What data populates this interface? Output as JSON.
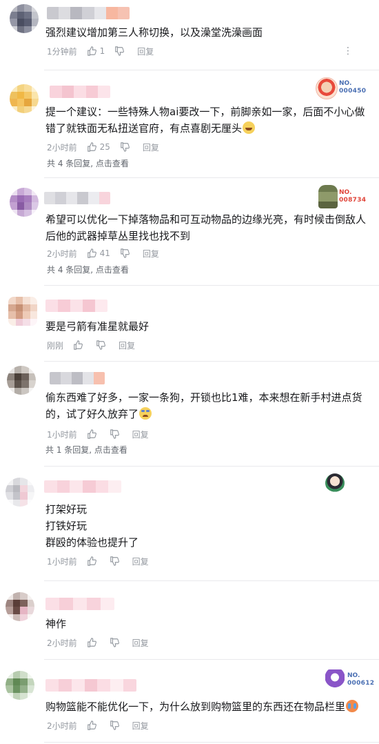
{
  "comments": [
    {
      "text": "强烈建议增加第三人称切换，以及澡堂洗澡画面",
      "time": "1分钟前",
      "likes": "1",
      "reply_label": "回复",
      "more_label": "⋮"
    },
    {
      "text": "提一个建议：一些特殊人物ai要改一下，前脚亲如一家，后面不小心做错了就铁面无私扭送官府，有点喜剧无厘头",
      "time": "2小时前",
      "likes": "25",
      "reply_label": "回复",
      "sub_replies": "共 4 条回复, 点击查看",
      "badge_no": "NO.",
      "badge_num": "000450"
    },
    {
      "text": "希望可以优化一下掉落物品和可互动物品的边缘光亮，有时候击倒敌人后他的武器掉草丛里找也找不到",
      "time": "2小时前",
      "likes": "41",
      "reply_label": "回复",
      "sub_replies": "共 4 条回复, 点击查看",
      "badge_no": "NO.",
      "badge_num": "008734"
    },
    {
      "text": "要是弓箭有准星就最好",
      "time": "刚刚",
      "likes": "",
      "reply_label": "回复"
    },
    {
      "text": "偷东西难了好多，一家一条狗，开锁也比1难，本来想在新手村进点货的，试了好久放弃了",
      "time": "1小时前",
      "likes": "",
      "reply_label": "回复",
      "sub_replies": "共 1 条回复, 点击查看"
    },
    {
      "text": "打架好玩\n打铁好玩\n群殴的体验也提升了",
      "time": "1小时前",
      "likes": "",
      "reply_label": "回复"
    },
    {
      "text": "神作",
      "time": "2小时前",
      "likes": "",
      "reply_label": "回复"
    },
    {
      "text": "购物篮能不能优化一下，为什么放到购物篮里的东西还在物品栏里",
      "time": "2小时前",
      "likes": "",
      "reply_label": "回复",
      "badge_no": "NO.",
      "badge_num": "000612"
    }
  ],
  "colors": {
    "text": "#18191c",
    "meta": "#9499a0",
    "badge": "#4a6fb3",
    "divider": "#e9e9ec"
  },
  "icons": [
    "thumbs-up-icon",
    "thumbs-down-icon",
    "more-vertical-icon"
  ]
}
